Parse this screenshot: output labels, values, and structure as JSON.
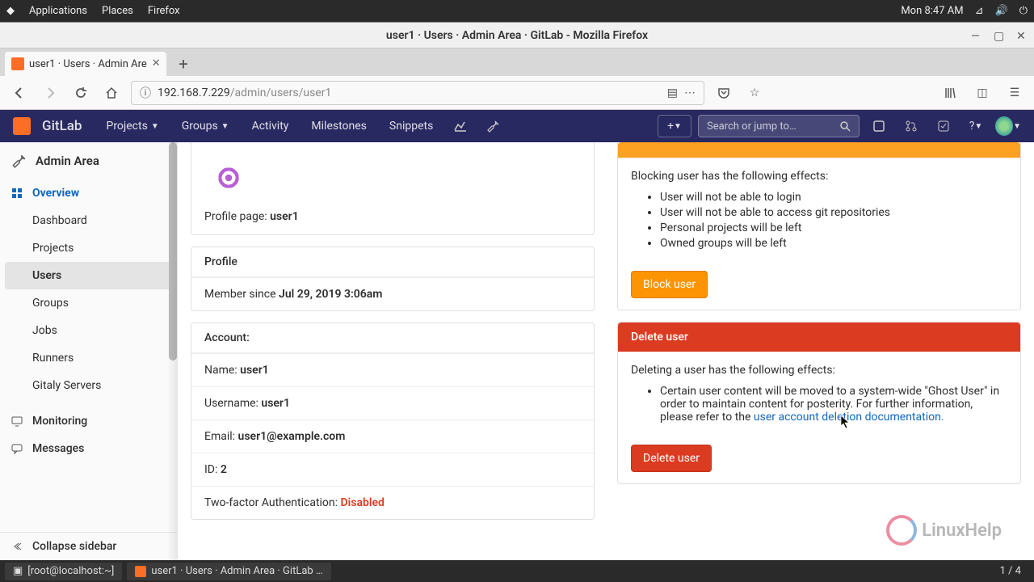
{
  "gnome": {
    "apps": "Applications",
    "places": "Places",
    "firefox": "Firefox",
    "clock": "Mon  8:47 AM"
  },
  "firefox": {
    "window_title": "user1 · Users · Admin Area · GitLab - Mozilla Firefox",
    "tab_title": "user1 · Users · Admin Are",
    "url_host": "192.168.7.229",
    "url_path": "/admin/users/user1"
  },
  "gitlab": {
    "brand": "GitLab",
    "nav": {
      "projects": "Projects",
      "groups": "Groups",
      "activity": "Activity",
      "milestones": "Milestones",
      "snippets": "Snippets"
    },
    "search_placeholder": "Search or jump to…"
  },
  "sidebar": {
    "title": "Admin Area",
    "overview": "Overview",
    "items": {
      "dashboard": "Dashboard",
      "projects": "Projects",
      "users": "Users",
      "groups": "Groups",
      "jobs": "Jobs",
      "runners": "Runners",
      "gitaly": "Gitaly Servers"
    },
    "monitoring": "Monitoring",
    "messages": "Messages",
    "collapse": "Collapse sidebar"
  },
  "user": {
    "profile_page_label": "Profile page: ",
    "profile_page_value": "user1",
    "profile_header": "Profile",
    "member_since_label": "Member since ",
    "member_since_value": "Jul 29, 2019 3:06am",
    "account_header": "Account:",
    "name_label": "Name: ",
    "name_value": "user1",
    "username_label": "Username: ",
    "username_value": "user1",
    "email_label": "Email: ",
    "email_value": "user1@example.com",
    "id_label": "ID: ",
    "id_value": "2",
    "twofa_label": "Two-factor Authentication: ",
    "twofa_value": "Disabled"
  },
  "block_panel": {
    "intro": "Blocking user has the following effects:",
    "effects": [
      "User will not be able to login",
      "User will not be able to access git repositories",
      "Personal projects will be left",
      "Owned groups will be left"
    ],
    "button": "Block user"
  },
  "delete_panel": {
    "header": "Delete user",
    "intro": "Deleting a user has the following effects:",
    "effect_prefix": "Certain user content will be moved to a system-wide \"Ghost User\" in order to maintain content for posterity. For further information, please refer to the ",
    "effect_link": "user account deletion documentation.",
    "button": "Delete user"
  },
  "taskbar": {
    "terminal": "[root@localhost:~]",
    "firefox": "user1 · Users · Admin Area · GitLab …",
    "pager": "1 / 4"
  },
  "watermark": "LinuxHelp"
}
